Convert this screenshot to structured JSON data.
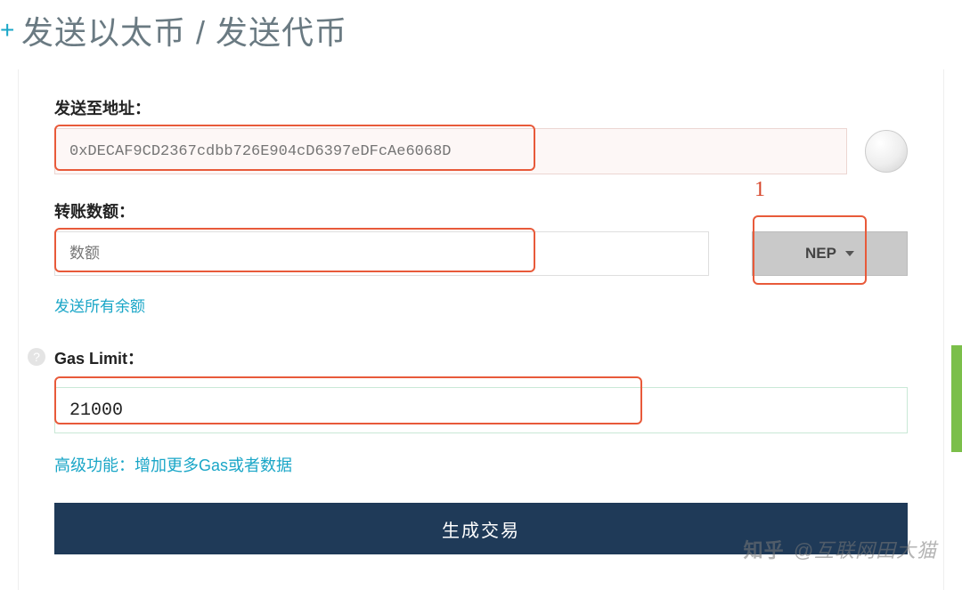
{
  "header": {
    "title": "发送以太币 / 发送代币"
  },
  "form": {
    "address": {
      "label": "发送至地址：",
      "placeholder": "0xDECAF9CD2367cdbb726E904cD6397eDFcAe6068D"
    },
    "amount": {
      "label": "转账数额：",
      "placeholder": "数额",
      "send_all_link": "发送所有余额",
      "token_selected": "NEP"
    },
    "gas": {
      "label": "Gas Limit：",
      "value": "21000",
      "advanced_link": "高级功能：增加更多Gas或者数据"
    },
    "buttons": {
      "generate": "生成交易"
    }
  },
  "annotations": {
    "marker_1": "1"
  },
  "watermark": {
    "brand": "知乎",
    "handle": "@互联网田大猫"
  }
}
